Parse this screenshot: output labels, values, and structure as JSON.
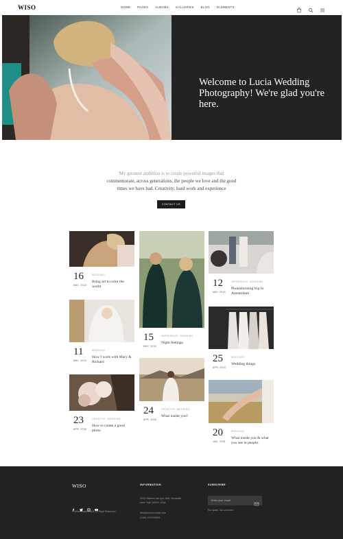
{
  "header": {
    "logo": "WISO",
    "nav": [
      "HOME",
      "PAGES",
      "ALBUMS",
      "GALLERIES",
      "BLOG",
      "ELEMENTS"
    ],
    "icons": [
      "cart-icon",
      "search-icon",
      "menu-icon"
    ]
  },
  "hero": {
    "title": "Welcome to Lucia Wedding Photography! We're glad you're here."
  },
  "intro": {
    "line1": "My greatest ambition is to create powerful images that",
    "line2": "commemorate, across generations, the people we love and the good",
    "line3": "times we have had. Creativity, hard work and experience",
    "button": "CONTACT US"
  },
  "posts": [
    {
      "day": "16",
      "month": "MAY, 2018",
      "category": "WEDDING",
      "title": "Bring art to color the world"
    },
    {
      "day": "11",
      "month": "MAY, 2018",
      "category": "WEDDING",
      "title": "How I work with Mary & Richard"
    },
    {
      "day": "23",
      "month": "APR, 2018",
      "category": "CREATIVE, WEDDING",
      "title": "How to create a good photo"
    },
    {
      "day": "15",
      "month": "MAY, 2018",
      "category": "IMPRESSIVE, WEDDING",
      "title": "Night feelings"
    },
    {
      "day": "24",
      "month": "APR, 2018",
      "category": "CREATIVE, WEDDING",
      "title": "What inside you?"
    },
    {
      "day": "12",
      "month": "MAY, 2018",
      "category": "IMPRESSIVE, WEDDING",
      "title": "Photoshooting trip to Amsterdam"
    },
    {
      "day": "25",
      "month": "APR, 2018",
      "category": "WEDDING",
      "title": "Wedding things"
    },
    {
      "day": "20",
      "month": "JAN, 2018",
      "category": "WEDDING",
      "title": "What inside you & what you see in people."
    }
  ],
  "footer": {
    "logo": "WISO",
    "copyright": "© Wiso Studio 2018. All Right Reserved.",
    "social": [
      "facebook-icon",
      "twitter-icon",
      "instagram-icon",
      "youtube-icon"
    ],
    "info_heading": "INFORMATION",
    "address1": "2005 Stokes Isle Apt. 896, Venaville,",
    "address2": "New York 10010, USA",
    "email": "info@yourdomain.com",
    "phone": "(+68) 120034509",
    "subscribe_heading": "SUBSCRIBE",
    "email_placeholder": "Enter your email",
    "no_spam": "No spam, we promise"
  },
  "colors": {
    "dark": "#222222",
    "button": "#1c1c1c",
    "muted": "#999999"
  }
}
